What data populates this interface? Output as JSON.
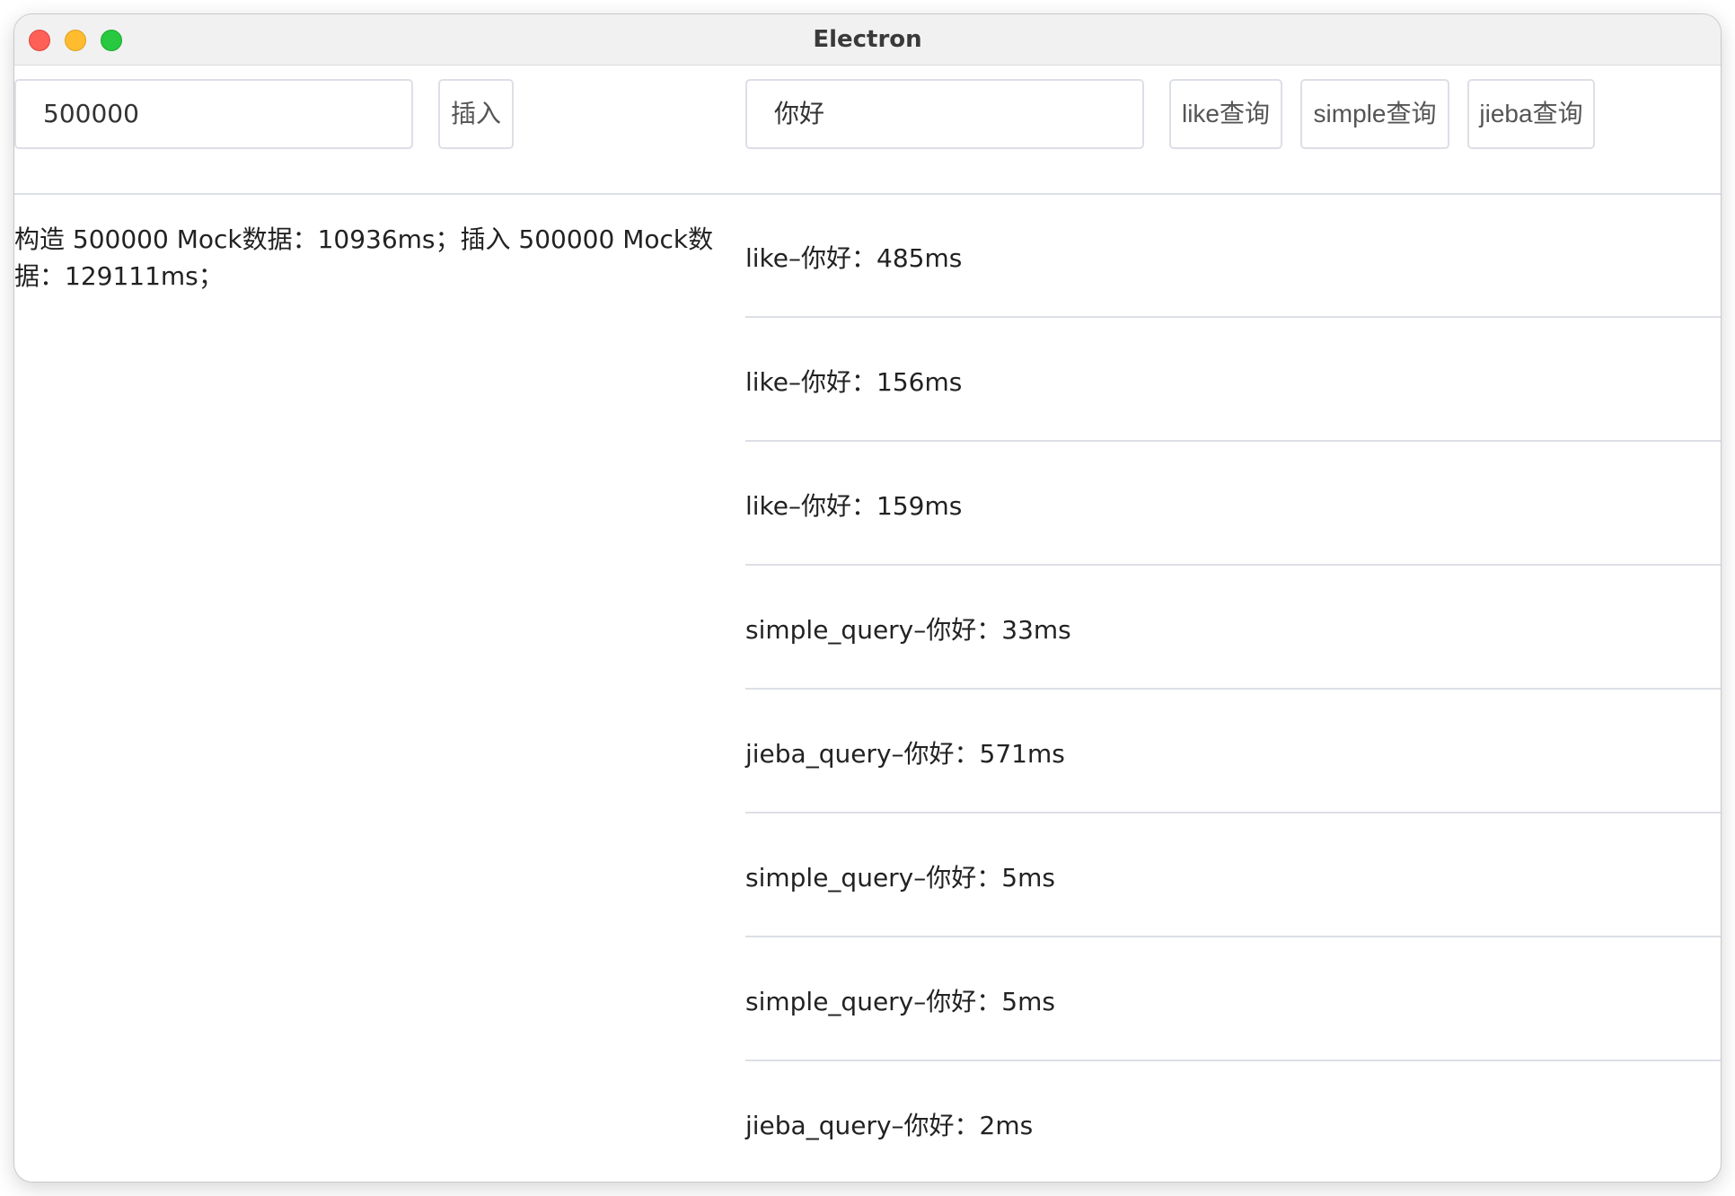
{
  "window": {
    "title": "Electron"
  },
  "toolbar": {
    "count_input_value": "500000",
    "insert_button_label": "插入",
    "query_input_value": "你好",
    "like_button_label": "like查询",
    "simple_button_label": "simple查询",
    "jieba_button_label": "jieba查询"
  },
  "left_log": {
    "text": "构造 500000 Mock数据：10936ms；插入 500000 Mock数据：129111ms；"
  },
  "results": [
    "like–你好：485ms",
    "like–你好：156ms",
    "like–你好：159ms",
    "simple_query–你好：33ms",
    "jieba_query–你好：571ms",
    "simple_query–你好：5ms",
    "simple_query–你好：5ms",
    "jieba_query–你好：2ms"
  ],
  "colors": {
    "close": "#fe5f57",
    "minimize": "#febc2e",
    "maximize": "#28c840",
    "border": "#dcdfe6"
  }
}
